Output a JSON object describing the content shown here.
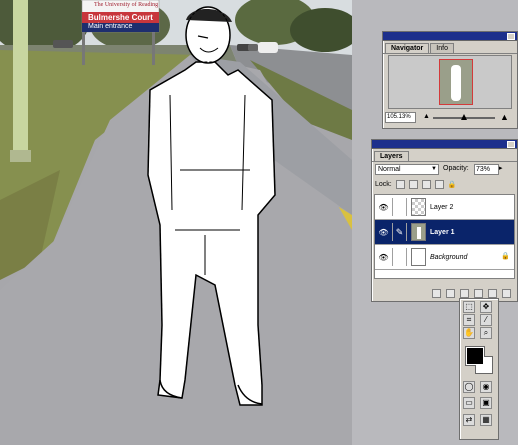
{
  "sign": {
    "university": "The University of Reading",
    "title": "Bulmershe Court",
    "subtitle": "Main entrance"
  },
  "navigator": {
    "tabs": [
      {
        "label": "Navigator",
        "active": true
      },
      {
        "label": "Info",
        "active": false
      }
    ],
    "zoom_value": "105.13%"
  },
  "layers": {
    "tab_label": "Layers",
    "blend_mode": "Normal",
    "opacity_label": "Opacity:",
    "opacity_value": "73%",
    "lock_label": "Lock:",
    "items": [
      {
        "name": "Layer 2",
        "selected": false,
        "thumb": "transparent"
      },
      {
        "name": "Layer 1",
        "selected": true,
        "thumb": "photo"
      },
      {
        "name": "Background",
        "selected": false,
        "thumb": "white",
        "locked": true
      }
    ],
    "bottom_icons": [
      "layer-style-icon",
      "mask-icon",
      "new-set-icon",
      "adjustment-icon",
      "new-layer-icon",
      "trash-icon"
    ]
  },
  "tools": [
    "marquee-icon",
    "move-icon",
    "lasso-icon",
    "wand-icon",
    "crop-icon",
    "slice-icon",
    "brush-icon",
    "stamp-icon",
    "eraser-icon",
    "gradient-icon",
    "hand-icon",
    "zoom-icon"
  ],
  "colors": {
    "accent": "#0a246a",
    "titlebar": "#1c2f8c",
    "proxy_box": "#d33a3a"
  }
}
